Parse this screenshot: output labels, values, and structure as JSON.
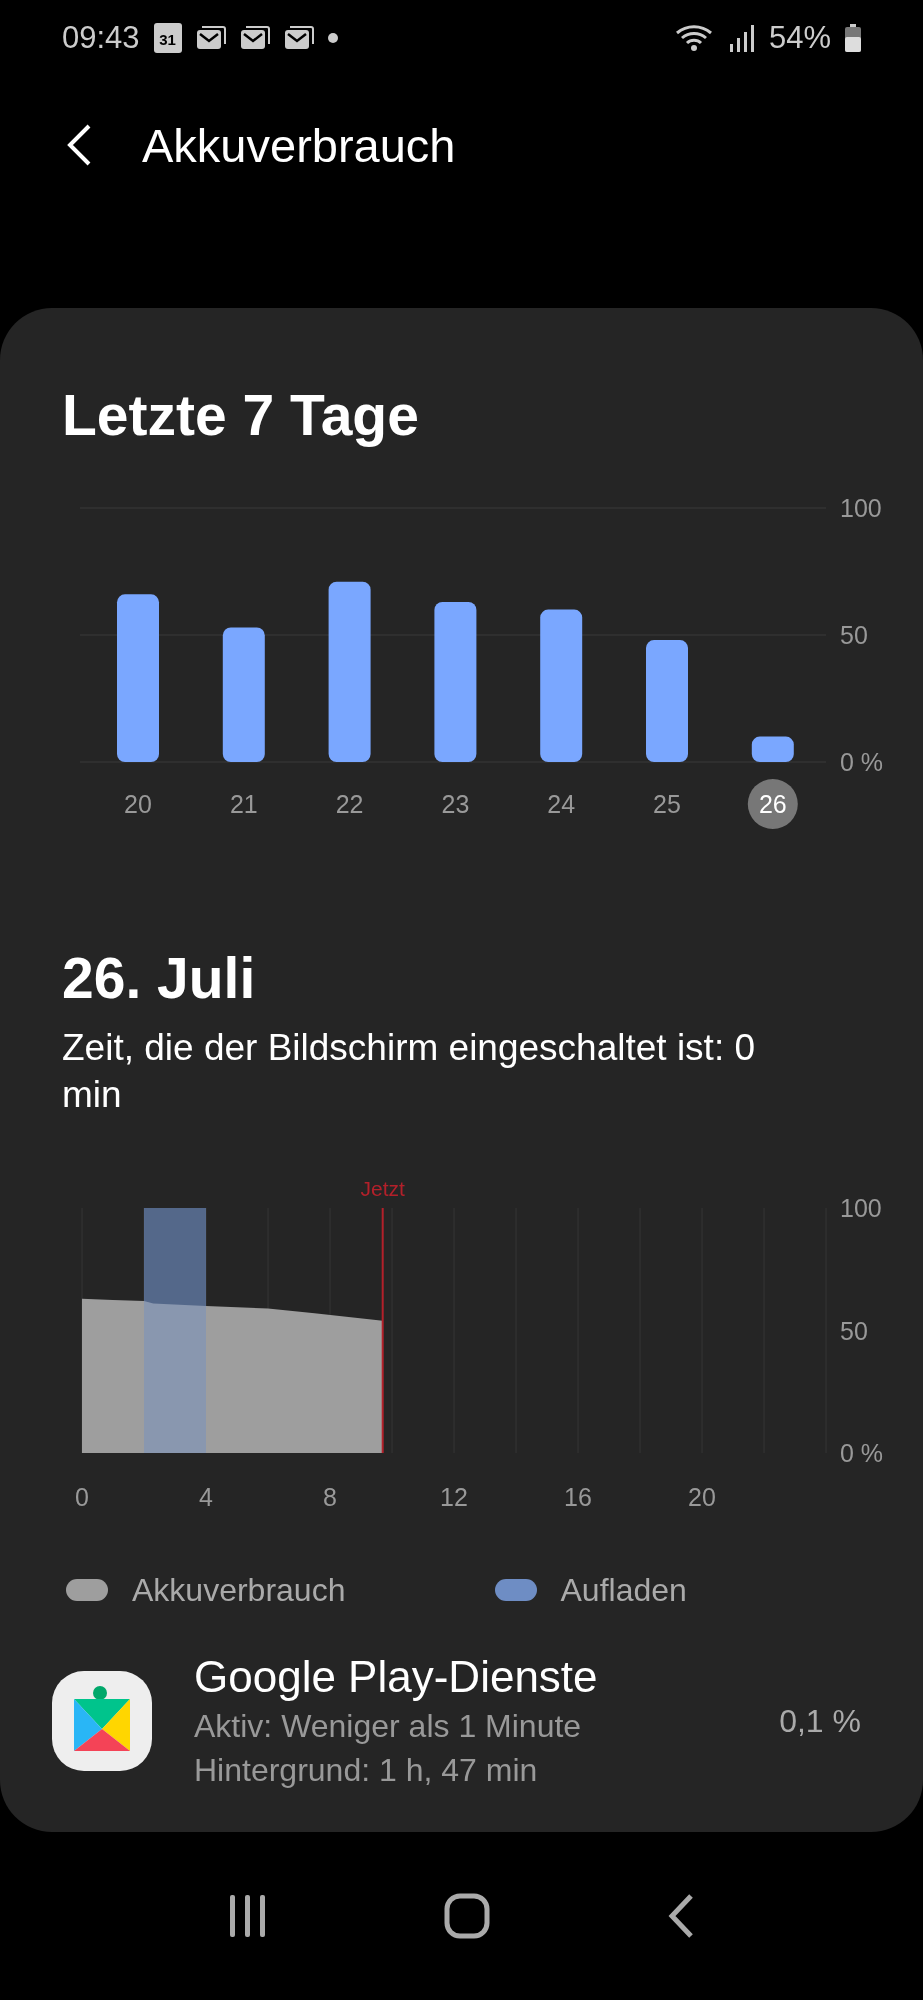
{
  "status_bar": {
    "time": "09:43",
    "notification_icons": [
      {
        "kind": "calendar",
        "label": "31"
      },
      {
        "kind": "mail"
      },
      {
        "kind": "mail"
      },
      {
        "kind": "mail"
      },
      {
        "kind": "dot"
      }
    ],
    "battery": "54%"
  },
  "header": {
    "title": "Akkuverbrauch"
  },
  "week": {
    "title": "Letzte 7 Tage",
    "day_selected": [
      false,
      false,
      false,
      false,
      false,
      false,
      true
    ],
    "chart_data": {
      "type": "bar",
      "categories": [
        "20",
        "21",
        "22",
        "23",
        "24",
        "25",
        "26"
      ],
      "values": [
        66,
        53,
        71,
        63,
        60,
        48,
        10
      ],
      "ylim": [
        0,
        100
      ],
      "yticks": [
        {
          "value": 0,
          "label": "0 %"
        },
        50,
        100
      ],
      "color": "#7aa7ff",
      "grid": true
    }
  },
  "day": {
    "title": "26. Juli",
    "screen_time": "Zeit, die der Bildschirm eingeschaltet ist: 0 min",
    "chart_data": {
      "type": "area",
      "x": [
        0,
        1,
        2,
        2.3,
        4,
        6,
        7.5,
        9.7
      ],
      "series": [
        {
          "color": "#9e9e9e",
          "values": [
            63,
            62.5,
            62,
            61,
            60,
            59,
            57,
            54
          ]
        }
      ],
      "xlim": [
        0,
        24
      ],
      "ylim": [
        0,
        100
      ],
      "xticks": [
        0,
        4,
        8,
        12,
        16,
        20
      ],
      "yticks": [
        {
          "value": 0,
          "label": "0 %"
        },
        50,
        100
      ],
      "grid": true,
      "bands": [
        {
          "axis": "x",
          "from": 2,
          "to": 4,
          "color": "#6e8dc4"
        }
      ],
      "ref_lines": [
        {
          "axis": "x",
          "value": 9.7,
          "label": "Jetzt",
          "color": "#b3202a"
        }
      ]
    }
  },
  "legend": [
    {
      "label": "Akkuverbrauch",
      "color": "#9e9e9e"
    },
    {
      "label": "Aufladen",
      "color": "#6e8dc4"
    }
  ],
  "apps": [
    {
      "name": "Google Play-Dienste",
      "active": "Aktiv: Weniger als 1 Minute",
      "background": "Hintergrund: 1 h, 47 min",
      "share": "0,1 %"
    }
  ]
}
